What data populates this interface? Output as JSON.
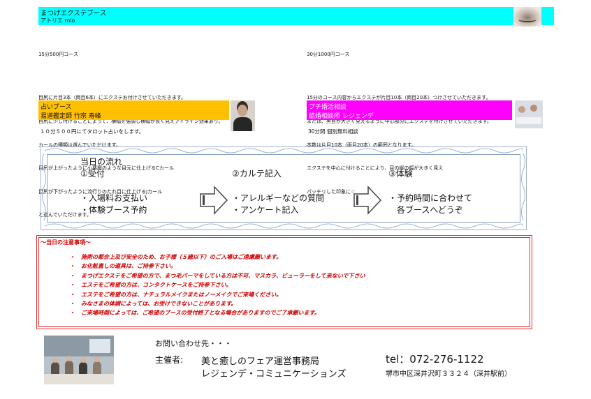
{
  "eyelash": {
    "title": "まつげエクステブース",
    "subtitle": "アトリエ mio",
    "left_heading": "15分500円コース",
    "left_lines": [
      "目尻に片目3本（両目6本）にエクステお付けさせていただきます。",
      "目尻に少し付けることによって、横幅を強調し横幅が長く見えアイライン効果あり。",
      "カールの種類は選んでいただけます。",
      "目尻が上がったように小悪魔のような目元に仕上げるCカール",
      "目尻が下がったように流行りのたれ目に仕上げるJカール",
      "と選んでいただけます。"
    ],
    "right_heading": "30分1000円コース",
    "right_lines": [
      "15分のコース内容からエクステが片目10本（両目20本）つけさせていただきます。",
      "または、黒目が大きく見えるように中心部分にエクステを付けさせていただきます。",
      "本数は片目10本（両目20本）の範囲となります。",
      "エクステを中心に付けることにより、目の縦の幅が大きく見え",
      "パッチリした印象に☆"
    ]
  },
  "fortune": {
    "title": "占いブース",
    "subtitle": "易道鑑定師 竹宗 寿峰",
    "note": "１０分５００円にてタロット占いをします。"
  },
  "marriage": {
    "title": "プチ婚活相談",
    "subtitle": "結婚相談所 レジェンデ",
    "note": "30分間 個別無料相談"
  },
  "flow": {
    "title": "当日の流れ",
    "steps": [
      {
        "label": "①受付",
        "items": [
          "・入場料お支払い",
          "・体験ブース予約"
        ]
      },
      {
        "label": "②カルテ記入",
        "items": [
          "・アレルギーなどの質問",
          "・アンケート記入"
        ]
      },
      {
        "label": "③体験",
        "items": [
          "・予約時間に合わせて",
          "　各ブースへどうぞ"
        ]
      }
    ]
  },
  "notice": {
    "title": "～当日の注意事項～",
    "items": [
      "施術の都合上及び安全のため、お子様（５歳以下）のご入場はご遠慮願います。",
      "お化粧直しの道具は、ご持参下さい。",
      "まつげエクステをご希望の方で、まつ毛パーマをしている方は不可、マスカラ、ビューラーをして来ないで下さい",
      "エステをご希望の方は、コンタクトケースをご持参下さい。",
      "エステをご希望の方は、ナチュラルメイクまたはノーメイクでご来場ください。",
      "みなさまの体調によっては、お受けできないことがあります。",
      "ご来場時間によっては、ご希望のブースの受付終了となる場合がありますのでご了承願います。"
    ]
  },
  "footer": {
    "contact_heading": "お問い合わせ先・・・",
    "organizer_label": "主催者:",
    "organizer_name": "美と癒しのフェア運営事務局",
    "company": "レジェンデ・コミュニケーションズ",
    "tel": "tel：072-276-1122",
    "address": "堺市中区深井沢町３３２４（深井駅前）"
  },
  "colors": {
    "eyelash_header": "#00ffff",
    "fortune_header": "#ffc000",
    "marriage_header": "#ff00ff",
    "notice_red": "#d00000",
    "flow_border": "#8aa0c0"
  }
}
